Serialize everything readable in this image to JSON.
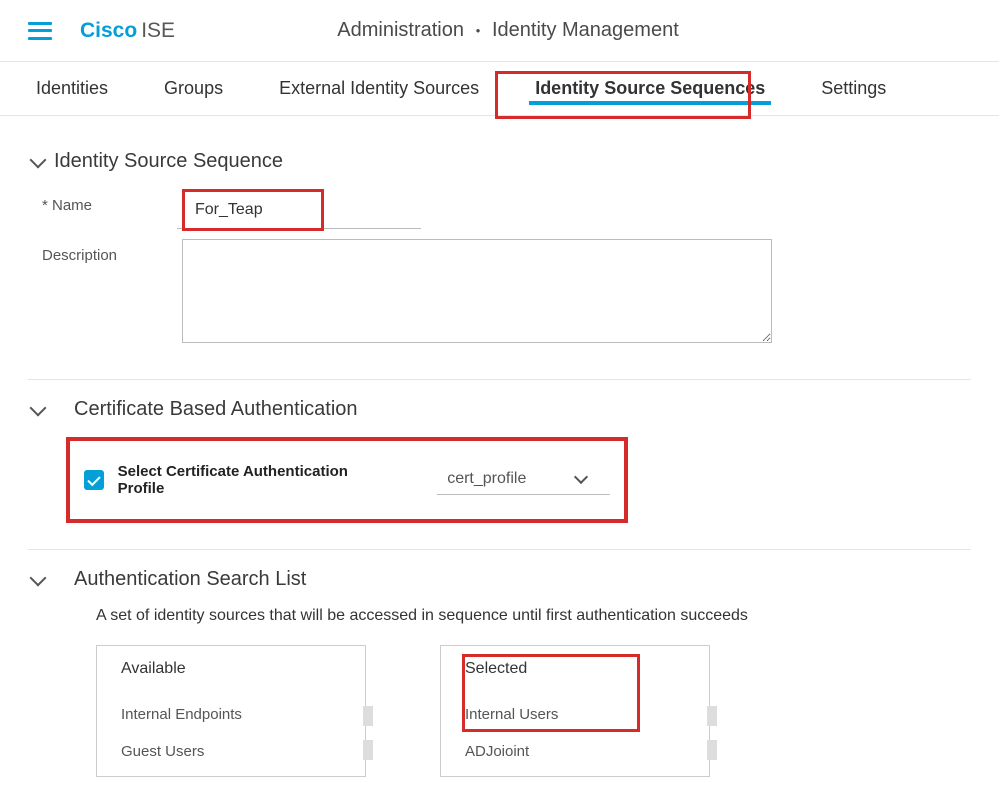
{
  "header": {
    "brand_left": "Cisco",
    "brand_right": "ISE",
    "crumb_a": "Administration",
    "crumb_b": "Identity Management"
  },
  "tabs": {
    "items": [
      {
        "label": "Identities"
      },
      {
        "label": "Groups"
      },
      {
        "label": "External Identity Sources"
      },
      {
        "label": "Identity Source Sequences"
      },
      {
        "label": "Settings"
      }
    ],
    "active_index": 3
  },
  "sections": {
    "idseq": {
      "title": "Identity Source Sequence",
      "name_label": "* Name",
      "name_value": "For_Teap",
      "desc_label": "Description",
      "desc_value": ""
    },
    "cert": {
      "title": "Certificate Based Authentication",
      "check_label": "Select Certificate Authentication Profile",
      "select_value": "cert_profile"
    },
    "search": {
      "title": "Authentication Search List",
      "description": "A set of identity sources that will be accessed in sequence until first authentication succeeds",
      "available_title": "Available",
      "selected_title": "Selected",
      "available": [
        "Internal Endpoints",
        "Guest Users"
      ],
      "selected": [
        "Internal Users",
        "ADJoioint"
      ]
    }
  }
}
